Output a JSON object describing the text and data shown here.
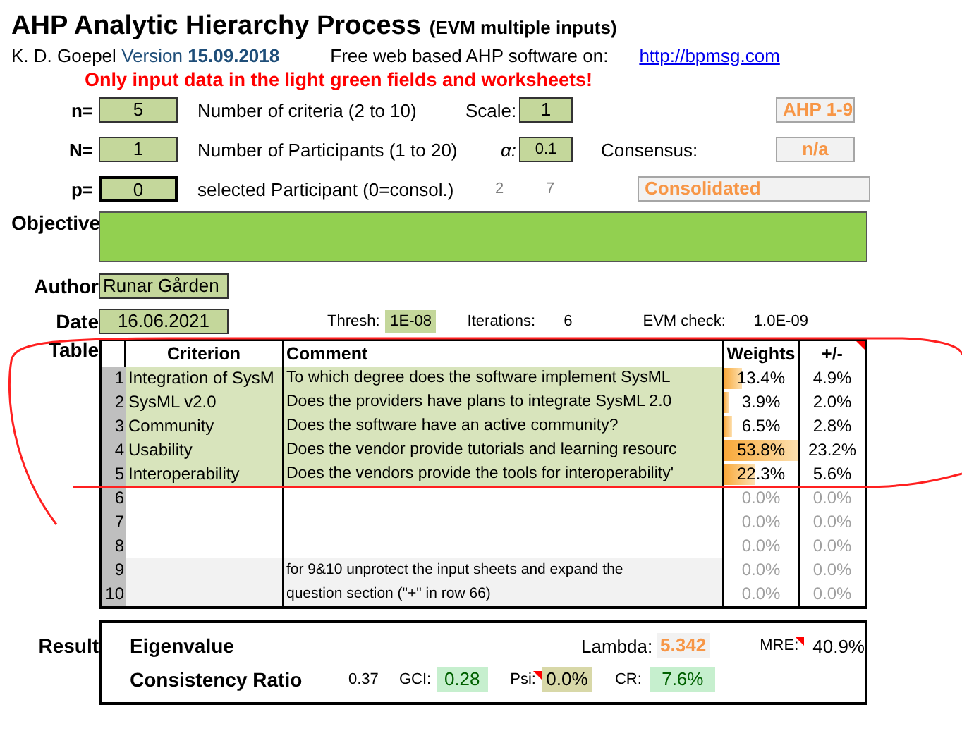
{
  "header": {
    "title": "AHP Analytic Hierarchy Process",
    "subtitle": "(EVM multiple inputs)",
    "author": "K. D. Goepel",
    "version_label": "Version",
    "version": "15.09.2018",
    "free_text": "Free web based AHP software on:",
    "link": "http://bpmsg.com",
    "warning": "Only input data in the light green fields and worksheets!"
  },
  "params": [
    {
      "label": "n=",
      "value": "5",
      "active": false,
      "description": "Number of criteria (2 to 10)",
      "side_label": "Scale:",
      "side_value": "1",
      "tag": "AHP 1-9"
    },
    {
      "label": "N=",
      "value": "1",
      "active": false,
      "description": "Number of Participants (1 to 20)",
      "side_label": "α:",
      "side_value": "0.1",
      "tag_label": "Consensus:",
      "tag": "n/a"
    },
    {
      "label": "p=",
      "value": "0",
      "active": true,
      "description": "selected Participant (0=consol.)",
      "extras": [
        "2",
        "7"
      ],
      "tag": "Consolidated"
    }
  ],
  "objective": {
    "label": "Objective"
  },
  "author": {
    "label": "Author",
    "value": "Runar Gården"
  },
  "date": {
    "label": "Date",
    "value": "16.06.2021",
    "thresh_label": "Thresh:",
    "thresh": "1E-08",
    "iterations_label": "Iterations:",
    "iterations": "6",
    "evm_label": "EVM check:",
    "evm": "1.0E-09"
  },
  "table": {
    "label": "Table",
    "columns": [
      "Criterion",
      "Comment",
      "Weights",
      "+/-"
    ],
    "rows": [
      {
        "num": "1",
        "kind": "input",
        "criterion": "Integration of SysM",
        "comment": "To which degree does the software implement SysML",
        "weight": "13.4%",
        "level": 0.25,
        "pm": "4.9%"
      },
      {
        "num": "2",
        "kind": "input",
        "criterion": "SysML v2.0",
        "comment": "Does the providers have plans to integrate SysML 2.0",
        "weight": "3.9%",
        "level": 0.07,
        "pm": "2.0%"
      },
      {
        "num": "3",
        "kind": "input",
        "criterion": "Community",
        "comment": "Does the software have an active community?",
        "weight": "6.5%",
        "level": 0.12,
        "pm": "2.8%"
      },
      {
        "num": "4",
        "kind": "input",
        "criterion": "Usability",
        "comment": "Does the vendor provide tutorials and learning resourc",
        "weight": "53.8%",
        "level": 1,
        "pm": "23.2%"
      },
      {
        "num": "5",
        "kind": "input",
        "criterion": "Interoperability",
        "comment": "Does the vendors provide the tools for interoperability'",
        "weight": "22.3%",
        "level": 0.42,
        "pm": "5.6%"
      },
      {
        "num": "6",
        "kind": "empty",
        "weight": "0.0%",
        "pm": "0.0%"
      },
      {
        "num": "7",
        "kind": "empty",
        "weight": "0.0%",
        "pm": "0.0%"
      },
      {
        "num": "8",
        "kind": "empty",
        "weight": "0.0%",
        "pm": "0.0%"
      },
      {
        "num": "9",
        "kind": "note",
        "comment": "for 9&10 unprotect the input sheets and expand the",
        "weight": "0.0%",
        "pm": "0.0%"
      },
      {
        "num": "10",
        "kind": "note",
        "comment": "question section (\"+\" in row 66)",
        "weight": "0.0%",
        "pm": "0.0%"
      }
    ]
  },
  "result": {
    "label": "Result",
    "eigenvalue": "Eigenvalue",
    "lambda_label": "Lambda:",
    "lambda": "5.342",
    "mre_label": "MRE:",
    "mre": "40.9%",
    "cr_title": "Consistency Ratio",
    "cr_raw": "0.37",
    "gci_label": "GCI:",
    "gci": "0.28",
    "psi_label": "Psi:",
    "psi": "0.0%",
    "cr_label": "CR:",
    "cr": "7.6%"
  }
}
